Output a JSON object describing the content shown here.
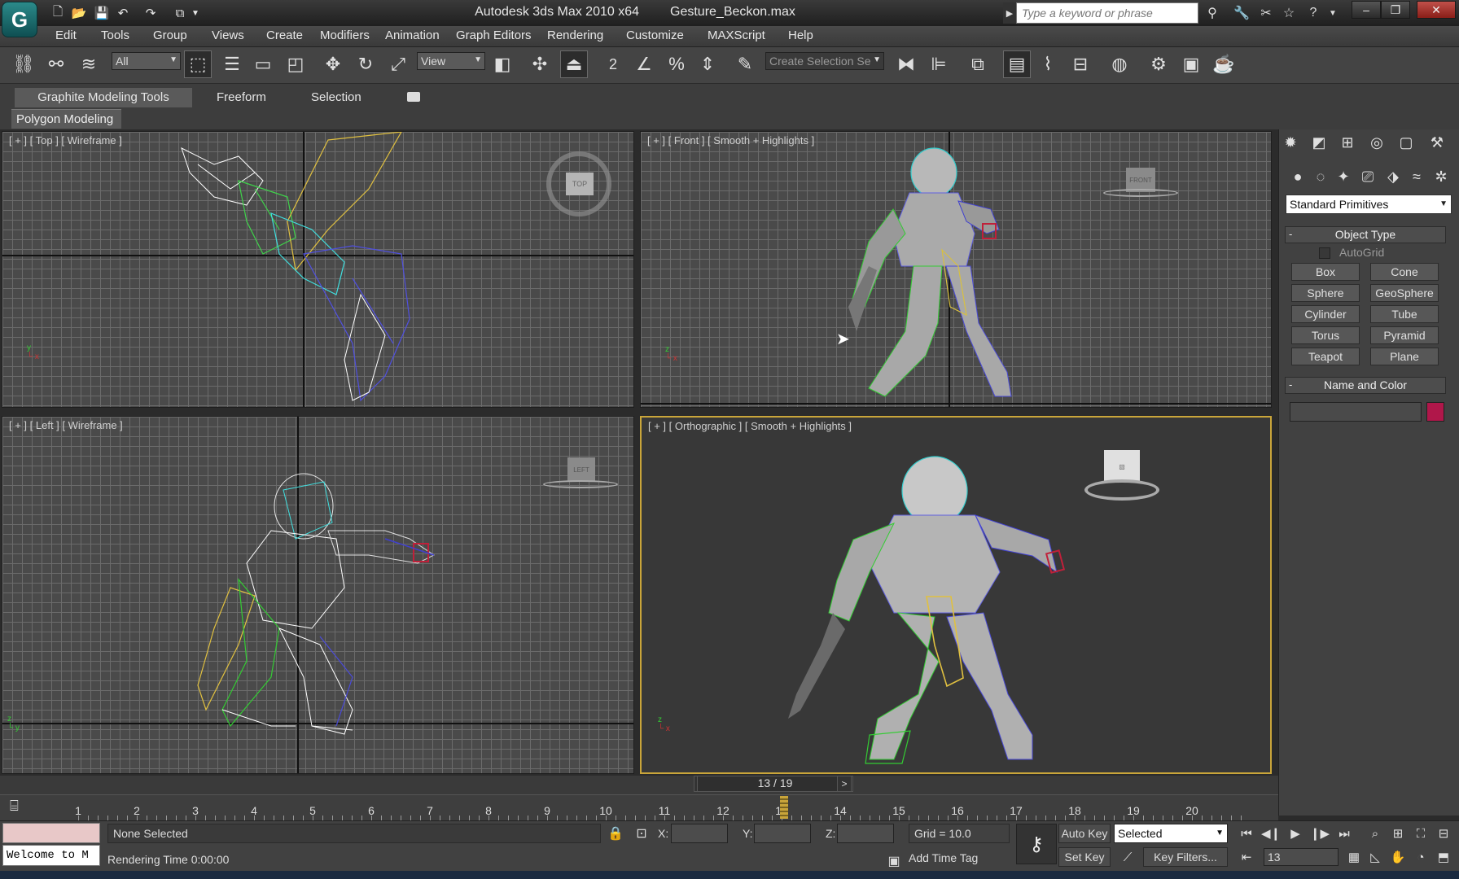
{
  "app": {
    "logo": "G",
    "title_app": "Autodesk 3ds Max  2010 x64",
    "title_file": "Gesture_Beckon.max"
  },
  "search": {
    "placeholder": "Type a keyword or phrase"
  },
  "menus": [
    "Edit",
    "Tools",
    "Group",
    "Views",
    "Create",
    "Modifiers",
    "Animation",
    "Graph Editors",
    "Rendering",
    "Customize",
    "MAXScript",
    "Help"
  ],
  "toolbar": {
    "selection_filter": "All",
    "reference_coord": "View",
    "named_selection_placeholder": "Create Selection Se",
    "snap_label": "2"
  },
  "ribbon": {
    "tabs": [
      "Graphite Modeling Tools",
      "Freeform",
      "Selection"
    ],
    "panel_button": "Polygon Modeling"
  },
  "viewports": {
    "top": "[ + ] [ Top ] [ Wireframe ]",
    "front": "[ + ] [ Front ] [ Smooth + Highlights ]",
    "left": "[ + ] [ Left ] [ Wireframe ]",
    "perspective": "[ + ] [ Orthographic ] [ Smooth + Highlights ]",
    "cube_top": "TOP",
    "cube_front": "FRONT",
    "cube_left": "LEFT"
  },
  "command_panel": {
    "category_dropdown": "Standard Primitives",
    "object_type_title": "Object Type",
    "autogrid": "AutoGrid",
    "objects": [
      "Box",
      "Cone",
      "Sphere",
      "GeoSphere",
      "Cylinder",
      "Tube",
      "Torus",
      "Pyramid",
      "Teapot",
      "Plane"
    ],
    "name_color_title": "Name and Color",
    "object_color": "#b0174a",
    "collapse_sign": "-"
  },
  "time_slider": {
    "frame_display": "13 / 19",
    "prev": "<",
    "next": ">",
    "current_frame": 13,
    "total_frames": 19
  },
  "trackbar": {
    "ticks": [
      "1",
      "2",
      "3",
      "4",
      "5",
      "6",
      "7",
      "8",
      "9",
      "10",
      "11",
      "12",
      "13",
      "14",
      "15",
      "16",
      "17",
      "18",
      "19",
      "20"
    ]
  },
  "status": {
    "maxscript_listener": "Welcome to M",
    "selection": "None Selected",
    "prompt": "Rendering Time  0:00:00",
    "x_label": "X:",
    "y_label": "Y:",
    "z_label": "Z:",
    "grid": "Grid = 10.0",
    "add_time_tag": "Add Time Tag",
    "auto_key": "Auto Key",
    "set_key": "Set Key",
    "key_mode": "Selected",
    "key_filters": "Key Filters...",
    "current_frame": "13"
  },
  "colors": {
    "accent_border": "#c9a53a",
    "viewport_bg": "#4a4a4a",
    "persp_bg": "#383838"
  }
}
